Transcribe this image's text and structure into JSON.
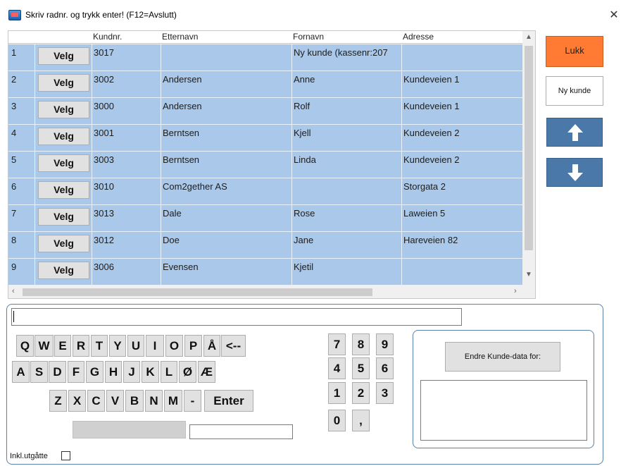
{
  "window": {
    "title": "Skriv radnr. og trykk enter! (F12=Avslutt)",
    "close_glyph": "✕"
  },
  "grid": {
    "columns": [
      "Kundnr.",
      "Etternavn",
      "Fornavn",
      "Adresse"
    ],
    "velg_label": "Velg",
    "rows": [
      {
        "num": "1",
        "kundnr": "3017",
        "etternavn": "",
        "fornavn": "Ny kunde (kassenr:207",
        "adresse": ""
      },
      {
        "num": "2",
        "kundnr": "3002",
        "etternavn": "Andersen",
        "fornavn": "Anne",
        "adresse": "Kundeveien 1"
      },
      {
        "num": "3",
        "kundnr": "3000",
        "etternavn": "Andersen",
        "fornavn": "Rolf",
        "adresse": "Kundeveien 1"
      },
      {
        "num": "4",
        "kundnr": "3001",
        "etternavn": "Berntsen",
        "fornavn": "Kjell",
        "adresse": "Kundeveien 2"
      },
      {
        "num": "5",
        "kundnr": "3003",
        "etternavn": "Berntsen",
        "fornavn": "Linda",
        "adresse": "Kundeveien 2"
      },
      {
        "num": "6",
        "kundnr": "3010",
        "etternavn": "Com2gether AS",
        "fornavn": "",
        "adresse": "Storgata 2"
      },
      {
        "num": "7",
        "kundnr": "3013",
        "etternavn": "Dale",
        "fornavn": "Rose",
        "adresse": "Laweien 5"
      },
      {
        "num": "8",
        "kundnr": "3012",
        "etternavn": "Doe",
        "fornavn": "Jane",
        "adresse": "Hareveien 82"
      },
      {
        "num": "9",
        "kundnr": "3006",
        "etternavn": "Evensen",
        "fornavn": "Kjetil",
        "adresse": ""
      }
    ]
  },
  "side_buttons": {
    "lukk": "Lukk",
    "ny_kunde": "Ny kunde"
  },
  "keyboard": {
    "row1": [
      "Q",
      "W",
      "E",
      "R",
      "T",
      "Y",
      "U",
      "I",
      "O",
      "P",
      "Å",
      "<--"
    ],
    "row2": [
      "A",
      "S",
      "D",
      "F",
      "G",
      "H",
      "J",
      "K",
      "L",
      "Ø",
      "Æ"
    ],
    "row3": [
      "Z",
      "X",
      "C",
      "V",
      "B",
      "N",
      "M",
      "-",
      "Enter"
    ],
    "numpad": [
      "7",
      "8",
      "9",
      "4",
      "5",
      "6",
      "1",
      "2",
      "3",
      "0",
      ","
    ]
  },
  "endre": {
    "button_label": "Endre Kunde-data for:"
  },
  "footer": {
    "inkl_label": "Inkl.utgåtte",
    "inkl_checked": false
  },
  "colors": {
    "row_bg": "#a9c8ea",
    "lukk_bg": "#ff7a33",
    "arrow_bg": "#4a78a8"
  }
}
